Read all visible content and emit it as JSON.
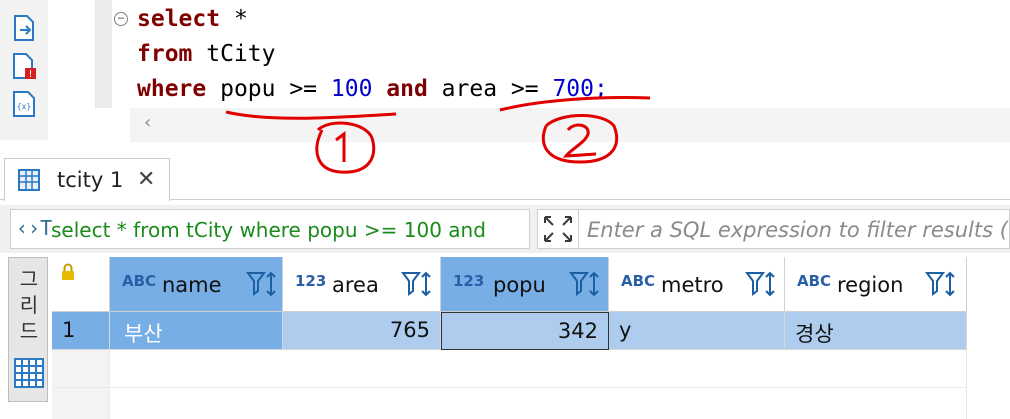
{
  "editor": {
    "lines": [
      {
        "kw": "select",
        "rest": " *"
      },
      {
        "kw": "from",
        "rest": " tCity"
      }
    ],
    "where_line": {
      "kw1": "where",
      "col1": " popu >= ",
      "num1": "100",
      "kw2": " and",
      "col2": " area >= ",
      "num2": "700",
      "end": ";"
    },
    "fold_symbol": "⊖",
    "scroll_left": "‹"
  },
  "results_tab": {
    "label": "tcity 1",
    "close": "✕"
  },
  "filter": {
    "sql_icon": "‹›T",
    "query_text": "select * from tCity where popu >= 100 and",
    "placeholder": "Enter a SQL expression to filter results (use Ctrl+Space)"
  },
  "side_panel": {
    "label": "그리드"
  },
  "grid": {
    "columns": [
      {
        "type": "ABC",
        "label": "name",
        "selected": true
      },
      {
        "type": "123",
        "label": "area",
        "selected": false
      },
      {
        "type": "123",
        "label": "popu",
        "selected": true
      },
      {
        "type": "ABC",
        "label": "metro",
        "selected": false
      },
      {
        "type": "ABC",
        "label": "region",
        "selected": false
      }
    ],
    "rows": [
      {
        "num": "1",
        "name": "부산",
        "area": "765",
        "popu": "342",
        "metro": "y",
        "region": "경상"
      }
    ]
  },
  "colors": {
    "keyword": "#7f0000",
    "number": "#0000cc",
    "filter_text": "#1a8a1a",
    "header_selected": "#78aee6",
    "row_selected": "#aecdee",
    "annotation": "#e00000"
  }
}
